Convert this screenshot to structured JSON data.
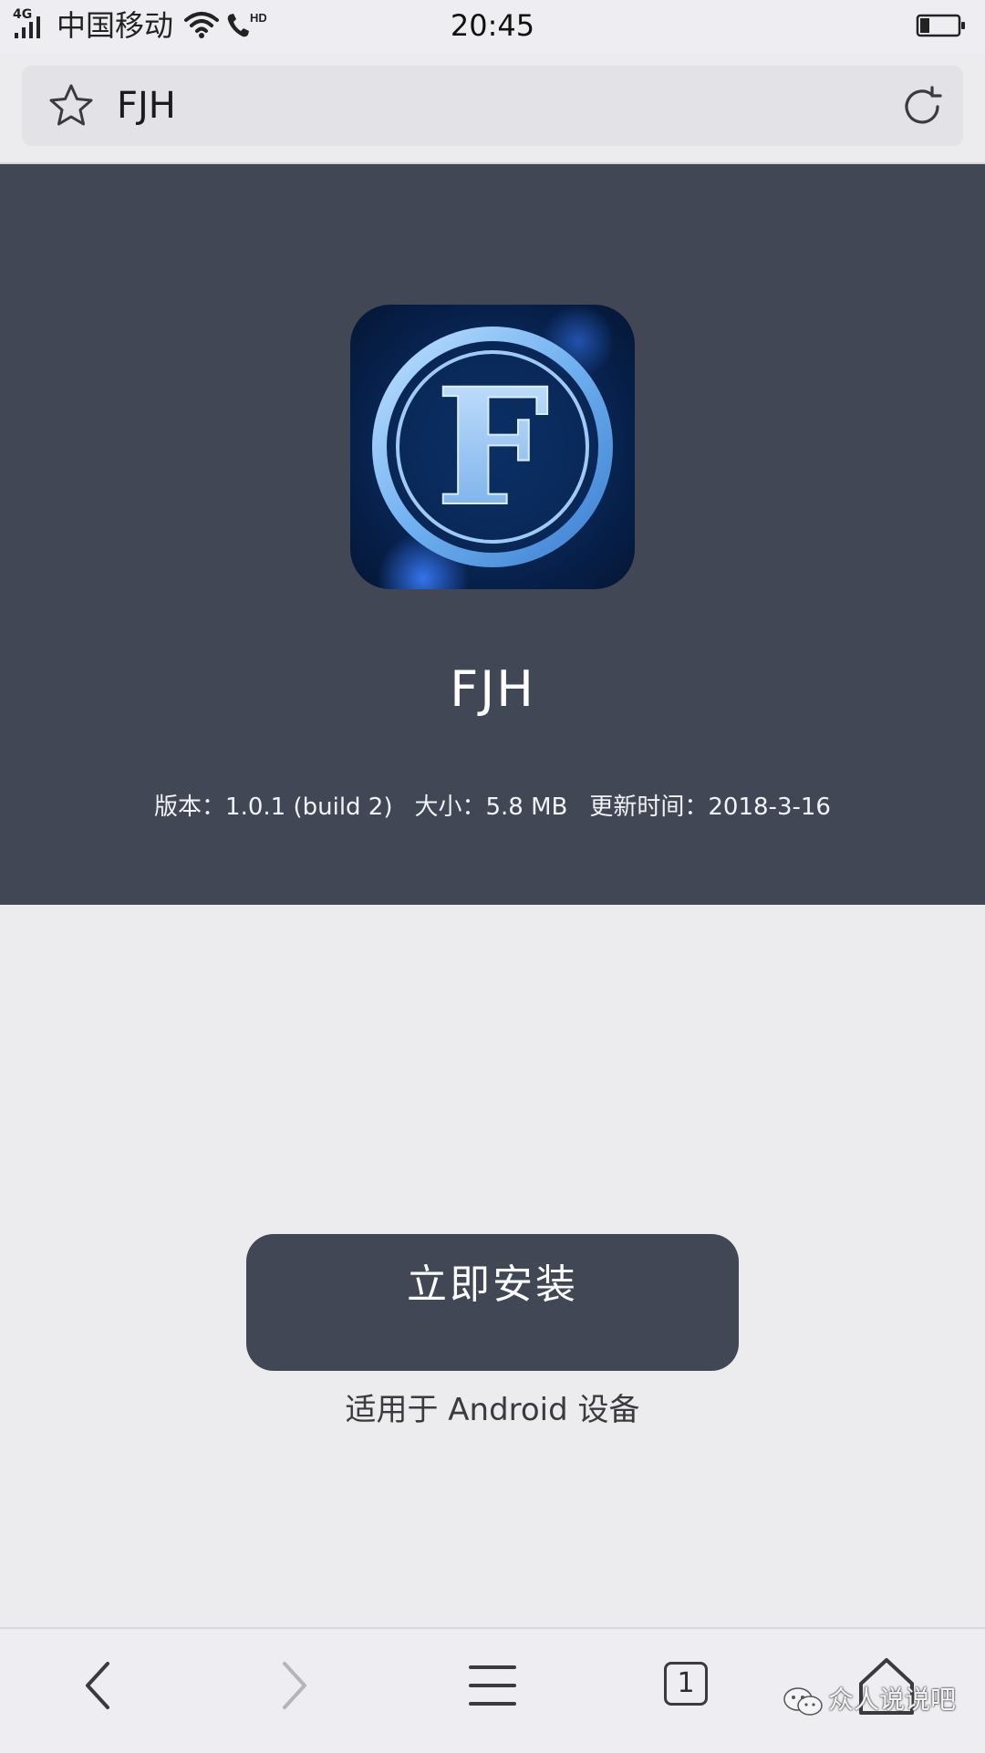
{
  "status_bar": {
    "network": "4G",
    "carrier": "中国移动",
    "call_badge": "HD",
    "time": "20:45",
    "battery_level": 0.25,
    "icons": [
      "signal-icon",
      "wifi-icon",
      "hd-call-icon",
      "battery-icon"
    ]
  },
  "url_bar": {
    "title": "FJH",
    "icons": [
      "star-icon",
      "reload-icon"
    ]
  },
  "app": {
    "name": "FJH",
    "version": "版本：1.0.1 (build 2)",
    "size": "大小：5.8 MB",
    "updated": "更新时间：2018-3-16",
    "icon_letter": "F",
    "colors": {
      "hero_bg": "#414755",
      "icon_bg": "#0a2a5a",
      "icon_ring": "#6fb0f0"
    }
  },
  "install": {
    "button_label": "立即安装",
    "note": "适用于 Android 设备"
  },
  "bottom_nav": {
    "tab_count": "1",
    "icons": [
      "back-icon",
      "forward-icon",
      "menu-icon",
      "tabs-icon",
      "home-icon"
    ]
  },
  "watermark": {
    "text": "众人说说吧",
    "icon": "wechat-icon"
  }
}
